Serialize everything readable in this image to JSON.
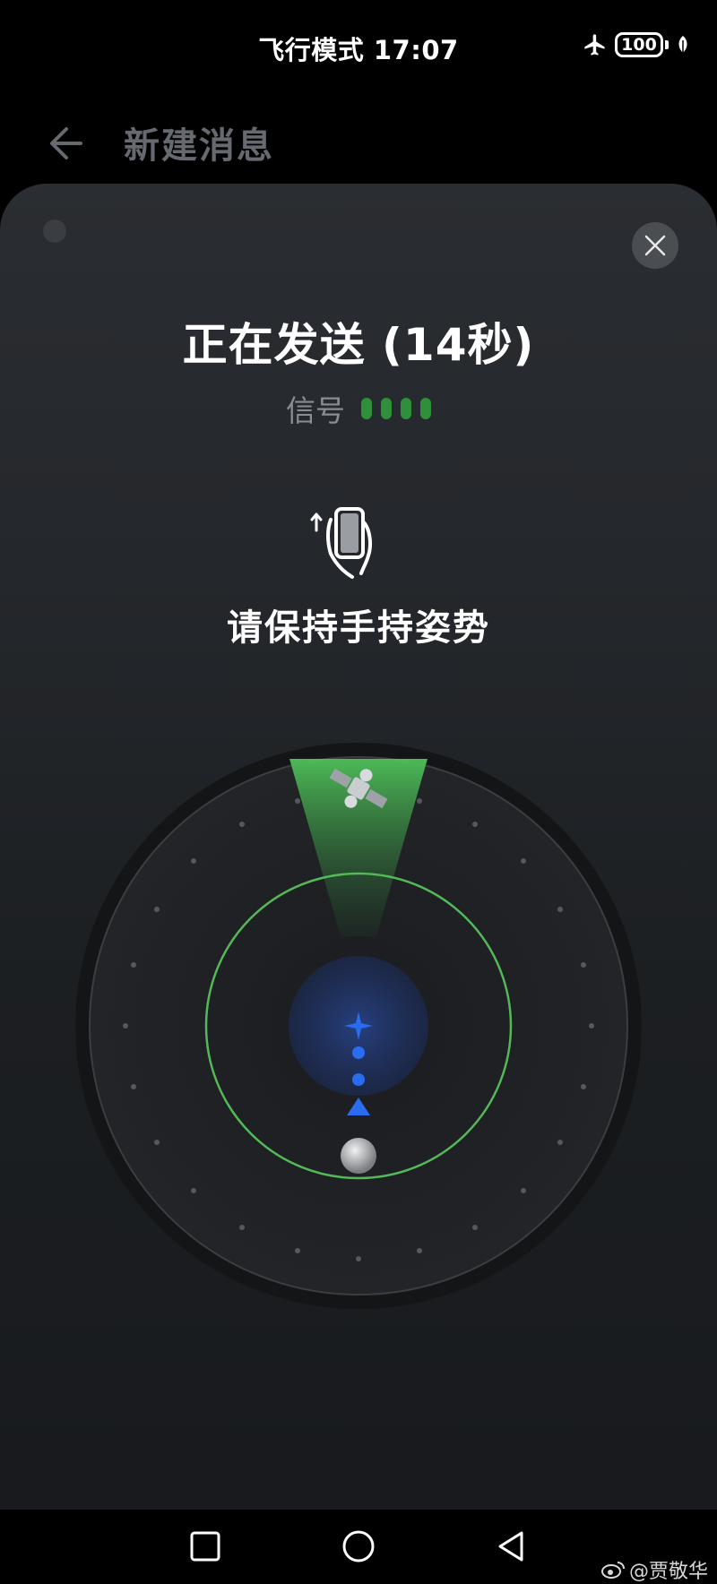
{
  "status_bar": {
    "center_text": "飞行模式 17:07",
    "battery_level": "100",
    "icons": [
      "airplane-icon",
      "battery-icon",
      "leaf-icon"
    ]
  },
  "app_bar": {
    "title": "新建消息",
    "back_icon": "back-arrow-icon"
  },
  "dialog": {
    "title": "正在发送 (14秒)",
    "signal_label": "信号",
    "signal_strength": 4,
    "signal_color": "#2f8f3a",
    "instruction": "请保持手持姿势",
    "close_icon": "close-icon"
  },
  "radar": {
    "beam_color": "#3cba54",
    "ring_color": "#5ccf60",
    "center_color": "#2a6cf0",
    "icons": [
      "satellite-icon",
      "crosshair-icon",
      "direction-triangle-icon",
      "earth-marker-icon"
    ]
  },
  "nav_bar": {
    "icons": [
      "recent-apps-icon",
      "home-icon",
      "back-icon"
    ]
  },
  "watermark": {
    "text": "@贾敬华"
  },
  "colors": {
    "background": "#000000",
    "sheet": "#24272b",
    "title_gray": "#666a70"
  }
}
